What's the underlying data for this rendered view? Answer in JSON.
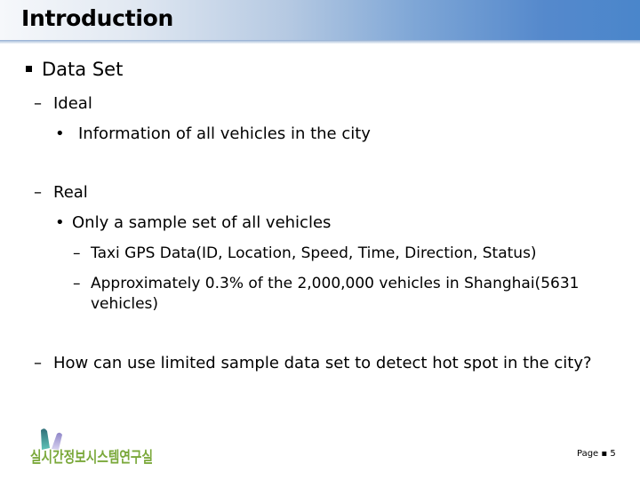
{
  "slide": {
    "title": "Introduction",
    "bullets": [
      {
        "level": 1,
        "marker": "square",
        "text": "Data Set"
      },
      {
        "level": 2,
        "marker": "–",
        "text": "Ideal"
      },
      {
        "level": 3,
        "marker": "•",
        "text": "Information of all vehicles in the city"
      },
      {
        "level": 2,
        "marker": "–",
        "text": "Real"
      },
      {
        "level": 3,
        "marker": "•",
        "text": "Only a sample set of all vehicles"
      },
      {
        "level": 4,
        "marker": "–",
        "text": "Taxi GPS Data(ID, Location, Speed, Time, Direction, Status)"
      },
      {
        "level": 4,
        "marker": "–",
        "text": "Approximately 0.3% of the 2,000,000 vehicles in Shanghai(5631",
        "continuation": "vehicles)"
      },
      {
        "level": 2,
        "marker": "–",
        "text": "How can use limited sample data set to detect hot spot in the city?"
      }
    ]
  },
  "footer": {
    "logo_text": "실시간정보시스템연구실",
    "page_label": "Page",
    "page_separator": "▪",
    "page_number": "5"
  },
  "colors": {
    "header_dark": "#4a86cb",
    "header_light": "#f6f8fb"
  }
}
